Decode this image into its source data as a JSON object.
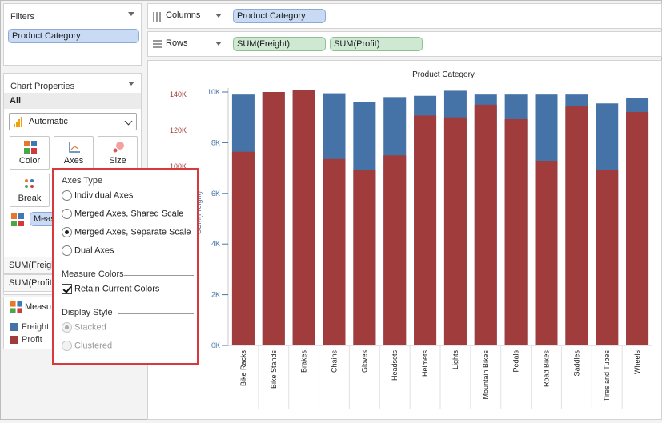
{
  "filters": {
    "title": "Filters",
    "pill": "Product Category"
  },
  "chart_properties": {
    "title": "Chart Properties",
    "scope": "All",
    "mark_type": "Automatic",
    "buttons": [
      "Color",
      "Axes",
      "Size",
      "Break"
    ],
    "measure_pill": "Meas",
    "measure_list": [
      "SUM(Freigh",
      "SUM(Profit)"
    ],
    "legend_title": "Measu",
    "legend": [
      {
        "label": "Freight",
        "color": "#4573a7"
      },
      {
        "label": "Profit",
        "color": "#a13c3c"
      }
    ]
  },
  "shelves": {
    "columns_label": "Columns",
    "columns_pill": "Product Category",
    "rows_label": "Rows",
    "rows_pills": [
      "SUM(Freight)",
      "SUM(Profit)"
    ]
  },
  "axes_popup": {
    "axes_type_title": "Axes Type",
    "axes_options": [
      {
        "label": "Individual Axes",
        "selected": false
      },
      {
        "label": "Merged Axes, Shared Scale",
        "selected": false
      },
      {
        "label": "Merged Axes, Separate Scale",
        "selected": true
      },
      {
        "label": "Dual Axes",
        "selected": false
      }
    ],
    "measure_colors_title": "Measure Colors",
    "retain_colors_label": "Retain Current Colors",
    "retain_colors_checked": true,
    "display_style_title": "Display Style",
    "display_options": [
      {
        "label": "Stacked",
        "selected": true,
        "disabled": true
      },
      {
        "label": "Clustered",
        "selected": false,
        "disabled": true
      }
    ]
  },
  "chart_data": {
    "type": "bar",
    "title": "Product Category",
    "categories": [
      "Bike Racks",
      "Bike Stands",
      "Brakes",
      "Chains",
      "Gloves",
      "Headsets",
      "Helmets",
      "Lights",
      "Mountain Bikes",
      "Pedals",
      "Road Bikes",
      "Saddles",
      "Tires and Tubes",
      "Wheels"
    ],
    "series": [
      {
        "name": "Freight",
        "color": "#4573a7",
        "axis": "right",
        "values": [
          9900,
          10000,
          10050,
          9950,
          9600,
          9800,
          9850,
          10050,
          9900,
          9900,
          9900,
          9900,
          9550,
          9750
        ]
      },
      {
        "name": "Profit",
        "color": "#a13c3c",
        "axis": "left",
        "values": [
          107000,
          140000,
          141000,
          103000,
          97000,
          105000,
          127000,
          126000,
          133000,
          125000,
          102000,
          132000,
          97000,
          129000
        ]
      }
    ],
    "left_axis": {
      "ticks": [
        "140K",
        "120K",
        "100K"
      ],
      "color": "#a13c3c",
      "ylim": [
        0,
        140000
      ]
    },
    "right_axis": {
      "ticks": [
        "10K",
        "8K",
        "6K",
        "4K",
        "2K",
        "0K"
      ],
      "color": "#4573a7",
      "ylim": [
        0,
        10000
      ]
    },
    "ylabel_right": "SUM(Freight)"
  }
}
